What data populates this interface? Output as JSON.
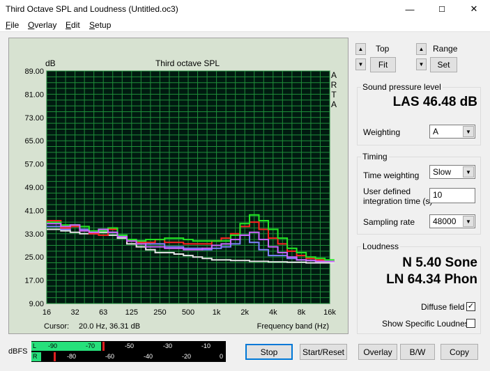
{
  "window": {
    "title": "Third Octave SPL and Loudness (Untitled.oc3)",
    "minimize": "—",
    "maximize": "☐",
    "close": "✕"
  },
  "menu": [
    {
      "first": "F",
      "rest": "ile"
    },
    {
      "first": "O",
      "rest": "verlay"
    },
    {
      "first": "E",
      "rest": "dit"
    },
    {
      "first": "S",
      "rest": "etup"
    }
  ],
  "graph": {
    "unit_label": "dB",
    "cursor_label": "Cursor:",
    "cursor_value": "20.0 Hz, 36.31 dB",
    "brand": [
      "A",
      "R",
      "T",
      "A"
    ]
  },
  "chart_data": {
    "type": "line",
    "title": "Third octave SPL",
    "xlabel": "Frequency band (Hz)",
    "ylabel": "dB",
    "ylim": [
      9,
      89
    ],
    "yticks": [
      "89.00",
      "81.00",
      "73.00",
      "65.00",
      "57.00",
      "49.00",
      "41.00",
      "33.00",
      "25.00",
      "17.00",
      "9.00"
    ],
    "xtick_labels": [
      "16",
      "32",
      "63",
      "125",
      "250",
      "500",
      "1k",
      "2k",
      "4k",
      "8k",
      "16k"
    ],
    "xtick_band_index": [
      0,
      3,
      6,
      9,
      12,
      15,
      18,
      21,
      24,
      27,
      30
    ],
    "bands": [
      "16",
      "20",
      "25",
      "31.5",
      "40",
      "50",
      "63",
      "80",
      "100",
      "125",
      "160",
      "200",
      "250",
      "315",
      "400",
      "500",
      "630",
      "800",
      "1k",
      "1.25k",
      "1.6k",
      "2k",
      "2.5k",
      "3.15k",
      "4k",
      "5k",
      "6.3k",
      "8k",
      "10k",
      "12.5k",
      "16k",
      "20k"
    ],
    "grid": true,
    "series": [
      {
        "color": "#e8e8e8",
        "values": [
          34.5,
          34.5,
          34.0,
          33.5,
          33.0,
          33.0,
          33.5,
          32.5,
          31.5,
          29.5,
          28.5,
          27.5,
          26.5,
          26.5,
          26.0,
          25.5,
          25.0,
          24.5,
          24.0,
          24.0,
          23.8,
          23.8,
          23.5,
          23.5,
          23.3,
          23.3,
          23.2,
          23.2,
          23.0,
          23.0,
          23.0,
          23.0
        ]
      },
      {
        "color": "#8080ff",
        "values": [
          35.5,
          35.5,
          34.5,
          35.5,
          34.5,
          33.5,
          34.0,
          33.5,
          32.5,
          31.0,
          30.5,
          29.5,
          29.5,
          28.5,
          28.5,
          28.0,
          28.0,
          27.5,
          28.0,
          28.5,
          29.5,
          32.5,
          30.0,
          27.5,
          25.5,
          25.5,
          24.5,
          24.0,
          23.8,
          23.8,
          23.5,
          23.5
        ]
      },
      {
        "color": "#ff2020",
        "values": [
          37.5,
          37.5,
          35.0,
          35.5,
          34.0,
          33.0,
          32.5,
          34.5,
          32.0,
          30.5,
          30.0,
          30.0,
          31.0,
          30.0,
          30.0,
          29.5,
          29.5,
          29.5,
          30.5,
          31.5,
          33.0,
          35.5,
          37.0,
          34.5,
          31.5,
          29.5,
          27.0,
          25.5,
          24.5,
          24.0,
          23.5,
          23.5
        ]
      },
      {
        "color": "#22e822",
        "values": [
          37.0,
          37.0,
          36.0,
          36.0,
          35.5,
          34.0,
          34.0,
          35.0,
          32.5,
          31.0,
          30.5,
          31.0,
          31.0,
          31.5,
          31.5,
          31.0,
          30.5,
          30.5,
          30.5,
          30.5,
          32.5,
          36.5,
          39.5,
          37.5,
          34.5,
          31.5,
          28.0,
          26.5,
          25.0,
          24.5,
          24.0,
          24.0
        ]
      },
      {
        "color": "#cc66ff",
        "values": [
          36.5,
          36.5,
          35.5,
          36.0,
          34.0,
          33.5,
          34.5,
          33.5,
          32.0,
          30.5,
          29.5,
          28.5,
          28.5,
          28.0,
          28.0,
          27.5,
          27.5,
          28.0,
          29.0,
          29.5,
          31.0,
          32.5,
          33.5,
          31.0,
          28.5,
          26.5,
          25.0,
          24.0,
          23.8,
          23.5,
          23.5,
          23.5
        ]
      }
    ]
  },
  "top_controls": {
    "top_label": "Top",
    "fit_label": "Fit",
    "range_label": "Range",
    "set_label": "Set",
    "up": "▲",
    "down": "▼"
  },
  "spl": {
    "title": "Sound pressure level",
    "value": "LAS 46.48 dB",
    "weighting_label": "Weighting",
    "weighting_value": "A"
  },
  "timing": {
    "title": "Timing",
    "time_weighting_label": "Time weighting",
    "time_weighting_value": "Slow",
    "integration_label_1": "User defined",
    "integration_label_2": "integration time (s)",
    "integration_value": "10",
    "sampling_label": "Sampling rate",
    "sampling_value": "48000"
  },
  "loudness": {
    "title": "Loudness",
    "n_value": "N 5.40 Sone",
    "ln_value": "LN 64.34 Phon",
    "diffuse_label": "Diffuse field",
    "diffuse_checked": "✓",
    "specific_label": "Show Specific Loudness"
  },
  "meter": {
    "label": "dBFS",
    "ch_left": "L",
    "ch_right": "R",
    "left_level": -64,
    "right_level": -95,
    "scale_min": -100,
    "scale_max": 0,
    "left_ticks": [
      "-90",
      "-70",
      "-50",
      "-30",
      "-10"
    ],
    "right_ticks": [
      "-80",
      "-60",
      "-40",
      "-20",
      "0"
    ]
  },
  "buttons": {
    "stop": "Stop",
    "start_reset": "Start/Reset",
    "overlay": "Overlay",
    "bw": "B/W",
    "copy": "Copy"
  }
}
